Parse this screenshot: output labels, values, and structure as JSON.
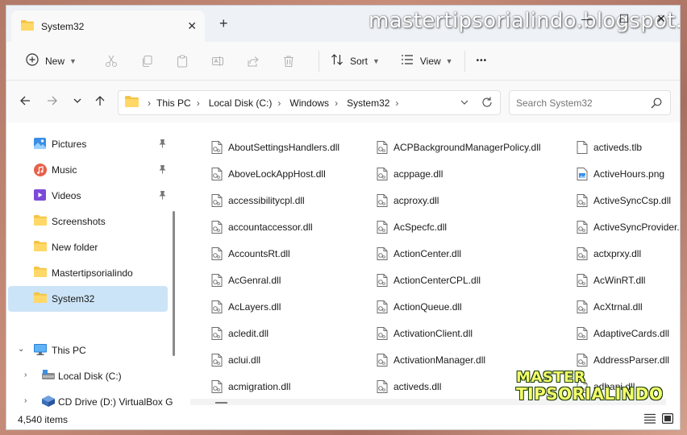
{
  "watermark": "mastertipsorialindo.blogspot.com",
  "logo": {
    "line1": "MASTER",
    "line2": "TIPSORIALINDO"
  },
  "tab": {
    "title": "System32",
    "close": "✕",
    "new": "+"
  },
  "window_buttons": {
    "minimize": "—",
    "maximize": "☐",
    "close": "✕"
  },
  "commands": {
    "new_label": "New",
    "sort_label": "Sort",
    "view_label": "View",
    "more": "•••"
  },
  "breadcrumb": [
    "This PC",
    "Local Disk (C:)",
    "Windows",
    "System32"
  ],
  "search": {
    "placeholder": "Search System32"
  },
  "nav": {
    "items": [
      {
        "label": "Pictures",
        "icon": "pictures-icon",
        "pinned": true
      },
      {
        "label": "Music",
        "icon": "music-icon",
        "pinned": true
      },
      {
        "label": "Videos",
        "icon": "videos-icon",
        "pinned": true
      },
      {
        "label": "Screenshots",
        "icon": "folder-icon"
      },
      {
        "label": "New folder",
        "icon": "folder-icon"
      },
      {
        "label": "Mastertipsorialindo",
        "icon": "folder-icon"
      },
      {
        "label": "System32",
        "icon": "folder-icon",
        "selected": true
      },
      {
        "label": "This PC",
        "icon": "this-pc-icon"
      },
      {
        "label": "Local Disk (C:)",
        "icon": "drive-icon"
      },
      {
        "label": "CD Drive (D:) VirtualBox G",
        "icon": "cd-drive-icon"
      }
    ]
  },
  "files": {
    "col1": [
      "AboutSettingsHandlers.dll",
      "AboveLockAppHost.dll",
      "accessibilitycpl.dll",
      "accountaccessor.dll",
      "AccountsRt.dll",
      "AcGenral.dll",
      "AcLayers.dll",
      "acledit.dll",
      "aclui.dll",
      "acmigration.dll"
    ],
    "col2": [
      "ACPBackgroundManagerPolicy.dll",
      "acppage.dll",
      "acproxy.dll",
      "AcSpecfc.dll",
      "ActionCenter.dll",
      "ActionCenterCPL.dll",
      "ActionQueue.dll",
      "ActivationClient.dll",
      "ActivationManager.dll",
      "activeds.dll"
    ],
    "col3": [
      "activeds.tlb",
      "ActiveHours.png",
      "ActiveSyncCsp.dll",
      "ActiveSyncProvider.dll",
      "actxprxy.dll",
      "AcWinRT.dll",
      "AcXtrnal.dll",
      "AdaptiveCards.dll",
      "AddressParser.dll",
      "adhapi.dll"
    ]
  },
  "status": {
    "count": "4,540 items"
  }
}
